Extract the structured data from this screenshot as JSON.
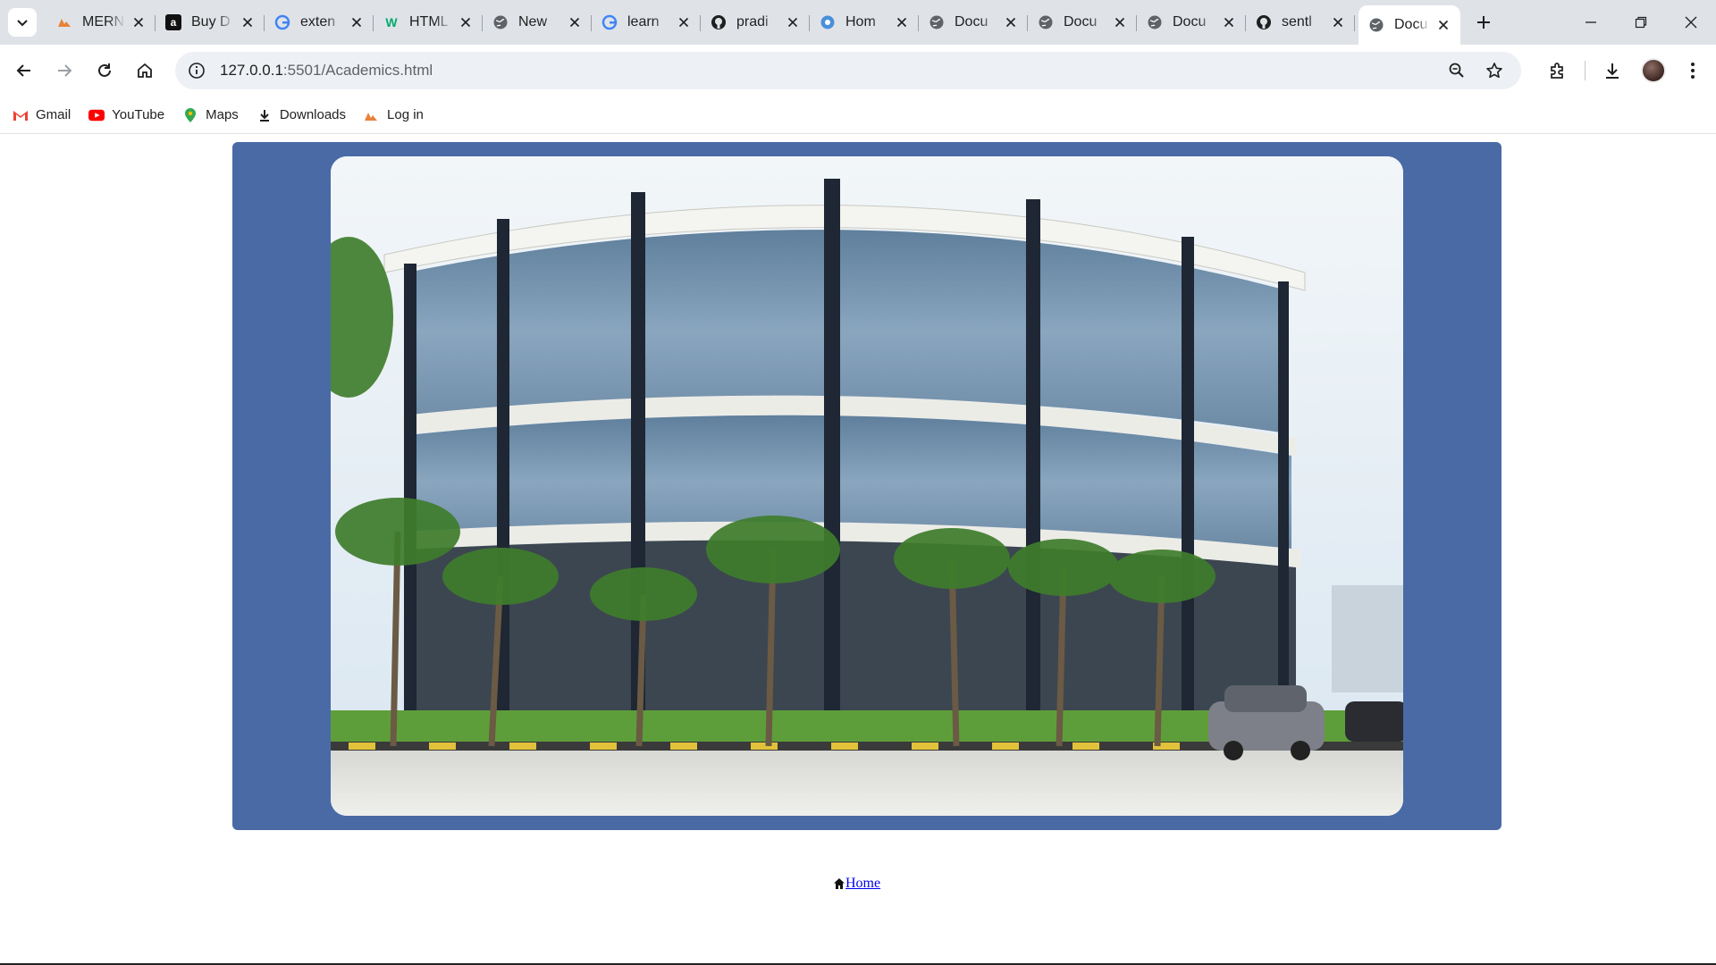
{
  "browser": {
    "tabs": [
      {
        "title": "MERN",
        "favicon": "mern-icon",
        "active": false
      },
      {
        "title": "Buy D",
        "favicon": "amazon-icon",
        "active": false
      },
      {
        "title": "exten",
        "favicon": "google-icon",
        "active": false
      },
      {
        "title": "HTML",
        "favicon": "w-icon",
        "active": false
      },
      {
        "title": "New",
        "favicon": "globe-icon",
        "active": false
      },
      {
        "title": "learn",
        "favicon": "google-icon",
        "active": false
      },
      {
        "title": "pradi",
        "favicon": "github-icon",
        "active": false
      },
      {
        "title": "Hom",
        "favicon": "globe-blue-icon",
        "active": false
      },
      {
        "title": "Docu",
        "favicon": "globe-icon",
        "active": false
      },
      {
        "title": "Docu",
        "favicon": "globe-icon",
        "active": false
      },
      {
        "title": "Docu",
        "favicon": "globe-icon",
        "active": false
      },
      {
        "title": "sentl",
        "favicon": "github-icon",
        "active": false
      },
      {
        "title": "Docu",
        "favicon": "globe-icon",
        "active": true
      }
    ],
    "address": {
      "host": "127.0.0.1",
      "path": ":5501/Academics.html"
    },
    "bookmarks": [
      {
        "label": "Gmail",
        "icon": "gmail-icon"
      },
      {
        "label": "YouTube",
        "icon": "youtube-icon"
      },
      {
        "label": "Maps",
        "icon": "maps-icon"
      },
      {
        "label": "Downloads",
        "icon": "download-icon"
      },
      {
        "label": "Log in",
        "icon": "login-icon"
      }
    ]
  },
  "page": {
    "banner_color": "#4a6aa5",
    "image_subject": "campus-building-photo",
    "home_link": "Home",
    "home_icon": "home-icon"
  }
}
